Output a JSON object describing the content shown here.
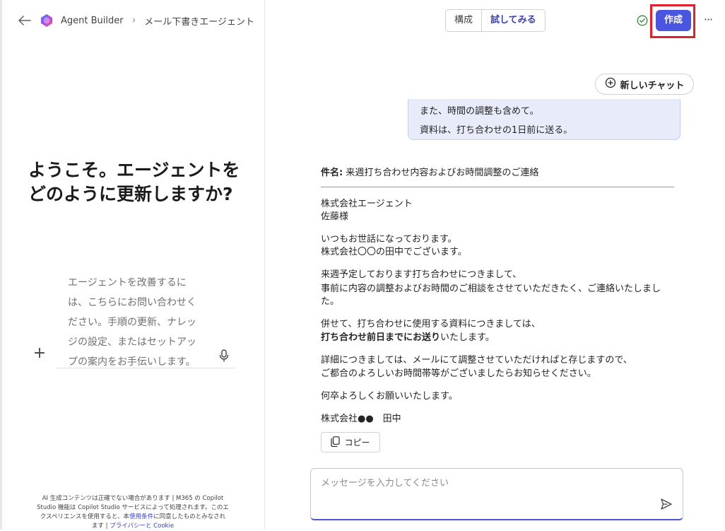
{
  "header": {
    "breadcrumb": [
      "Agent Builder",
      "メール下書きエージェント"
    ],
    "tabs": [
      {
        "label": "構成"
      },
      {
        "label": "試してみる"
      }
    ],
    "create_label": "作成",
    "more_label": "···"
  },
  "left_panel": {
    "welcome_title": "ようこそ。エージェントをどのように更新しますか?",
    "input_lines": [
      "エージェントを改善するに",
      "は、こちらにお問い合わせく",
      "ださい。手順の更新、ナレッ",
      "ジの設定、またはセットアッ",
      "プの案内をお手伝いします。"
    ],
    "disclaimer": {
      "line1": "AI 生成コンテンツは正確でない場合があります | M365 の Copilot",
      "line2": "Studio 機能は Copilot Studio サービスによって処理されます。このエ",
      "line3_pre": "クスペリエンスを使用すると、本",
      "terms_link": "使用条件",
      "line3_post": "に同意したものとみなされ",
      "line4_pre": "ます | ",
      "privacy_link": "プライバシーと Cookie"
    }
  },
  "chat": {
    "new_chat_label": "新しいチャット",
    "user_message": {
      "line1": "また、時間の調整も含めて。",
      "line2": "資料は、打ち合わせの1日前に送る。"
    },
    "response": {
      "subject_label": "件名:",
      "subject_text": "来週打ち合わせ内容およびお時間調整のご連絡",
      "lines": [
        "株式会社エージェント",
        "佐藤様",
        "いつもお世話になっております。",
        "株式会社〇〇の田中でございます。",
        "来週予定しております打ち合わせにつきまして、",
        "事前に内容の調整およびお時間のご相談をさせていただきたく、ご連絡いたしまし",
        "た。",
        "併せて、打ち合わせに使用する資料につきましては、",
        "打ち合わせ前日までにお送り",
        "いたします。",
        "詳細につきましては、メールにて調整させていただければと存じますので、",
        "ご都合のよろしいお時間帯等がございましたらお知らせください。",
        "何卒よろしくお願いいたします。",
        "株式会社●●　田中"
      ]
    },
    "copy_label": "コピー",
    "message_placeholder": "メッセージを入力してください"
  },
  "colors": {
    "accent": "#4a55e0",
    "highlight_border": "#e0202a",
    "user_bubble": "#e8ebfa"
  }
}
